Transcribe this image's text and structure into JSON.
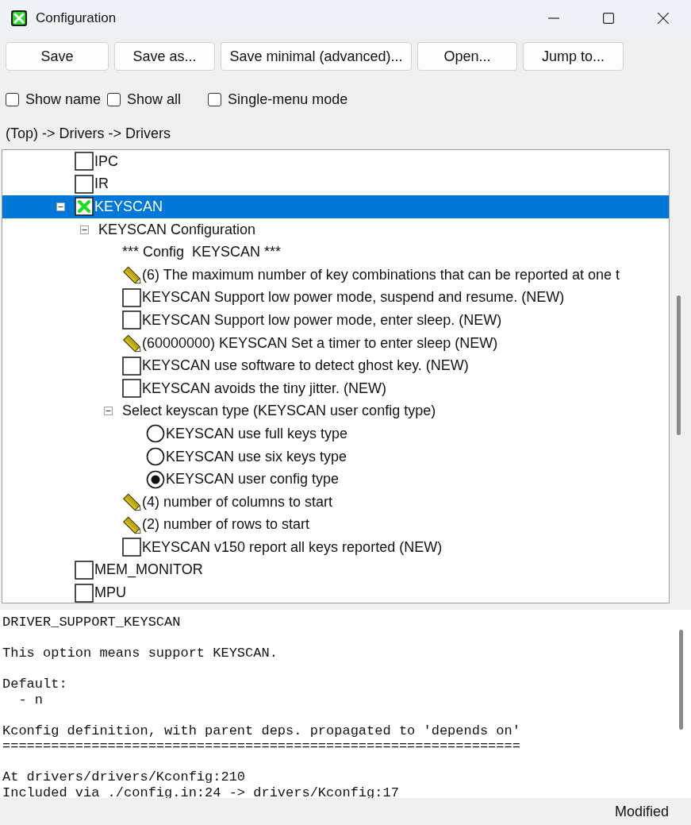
{
  "window": {
    "title": "Configuration"
  },
  "toolbar": {
    "buttons": [
      "Save",
      "Save as...",
      "Save minimal (advanced)...",
      "Open...",
      "Jump to..."
    ]
  },
  "options": [
    {
      "label": "Show name",
      "checked": false
    },
    {
      "label": "Show all",
      "checked": false
    },
    {
      "label": "Single-menu mode",
      "checked": false
    }
  ],
  "breadcrumb": "(Top) -> Drivers -> Drivers",
  "tree": [
    {
      "kind": "check",
      "label": "IPC",
      "checked": false,
      "selected": false
    },
    {
      "kind": "check",
      "label": "IR",
      "checked": false,
      "selected": false
    },
    {
      "kind": "check",
      "label": "KEYSCAN",
      "checked": true,
      "selected": true,
      "expanded": true,
      "children": [
        {
          "kind": "menu",
          "label": "KEYSCAN Configuration",
          "selected": false,
          "expanded": true,
          "children": [
            {
              "kind": "comment",
              "label": "*** Config  KEYSCAN ***",
              "selected": false
            },
            {
              "kind": "value",
              "label": "(6) The maximum number of key combinations that can be reported at one t",
              "selected": false
            },
            {
              "kind": "check",
              "label": "KEYSCAN Support low power mode, suspend and resume. (NEW)",
              "checked": false,
              "selected": false
            },
            {
              "kind": "check",
              "label": "KEYSCAN Support low power mode, enter sleep. (NEW)",
              "checked": false,
              "selected": false
            },
            {
              "kind": "value",
              "label": "(60000000) KEYSCAN Set a timer to enter sleep (NEW)",
              "selected": false
            },
            {
              "kind": "check",
              "label": "KEYSCAN use software to detect ghost key. (NEW)",
              "checked": false,
              "selected": false
            },
            {
              "kind": "check",
              "label": "KEYSCAN avoids the tiny jitter. (NEW)",
              "checked": false,
              "selected": false
            },
            {
              "kind": "menu",
              "label": "Select keyscan type (KEYSCAN user config type)",
              "selected": false,
              "expanded": true,
              "children": [
                {
                  "kind": "radio",
                  "label": "KEYSCAN use full keys type",
                  "checked": false,
                  "selected": false
                },
                {
                  "kind": "radio",
                  "label": "KEYSCAN use six keys type",
                  "checked": false,
                  "selected": false
                },
                {
                  "kind": "radio",
                  "label": "KEYSCAN user config type",
                  "checked": true,
                  "selected": false
                }
              ]
            },
            {
              "kind": "value",
              "label": "(4) number of columns to start",
              "selected": false
            },
            {
              "kind": "value",
              "label": "(2) number of rows to start",
              "selected": false
            },
            {
              "kind": "check",
              "label": "KEYSCAN v150 report all keys reported (NEW)",
              "checked": false,
              "selected": false
            }
          ]
        }
      ]
    },
    {
      "kind": "check",
      "label": "MEM_MONITOR",
      "checked": false,
      "selected": false
    },
    {
      "kind": "check",
      "label": "MPU",
      "checked": false,
      "selected": false
    }
  ],
  "info": {
    "blocks": [
      [
        "DRIVER_SUPPORT_KEYSCAN"
      ],
      [
        "This option means support KEYSCAN."
      ],
      [
        "Default:",
        "  - n"
      ],
      [
        "Kconfig definition, with parent deps. propagated to 'depends on'",
        "================================================================"
      ],
      [
        "At drivers/drivers/Kconfig:210",
        "Included via ./config.in:24 -> drivers/Kconfig:17"
      ]
    ]
  },
  "status_bar": "Modified"
}
